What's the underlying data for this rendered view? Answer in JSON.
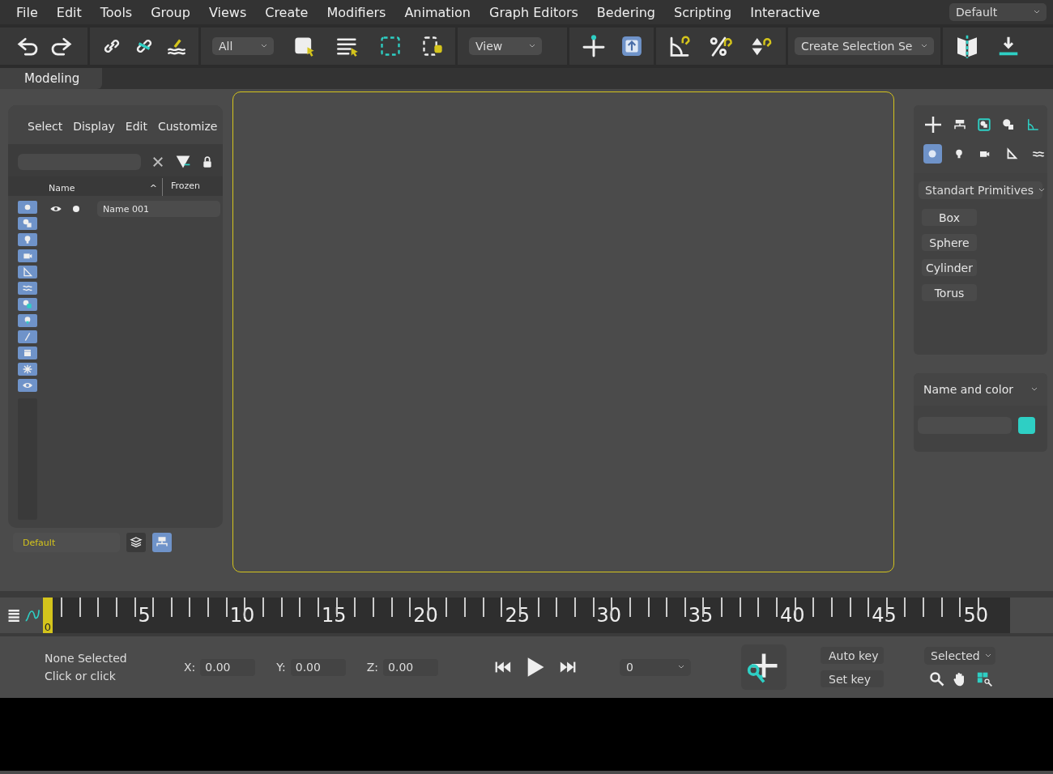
{
  "menu": [
    {
      "label": "File"
    },
    {
      "label": "Edit"
    },
    {
      "label": "Tools"
    },
    {
      "label": "Group"
    },
    {
      "label": "Views"
    },
    {
      "label": "Create"
    },
    {
      "label": "Modifiers"
    },
    {
      "label": "Animation"
    },
    {
      "label": "Graph Editors"
    },
    {
      "label": "Bedering"
    },
    {
      "label": "Scripting"
    },
    {
      "label": "Interactive"
    }
  ],
  "workspace": {
    "value": "Default"
  },
  "toolbar": {
    "selection_filter": "All",
    "reference_coordinate": "View",
    "named_selection": "Create Selection Se"
  },
  "ribbon_tabs": [
    {
      "label": "Modeling",
      "selected": true
    }
  ],
  "scene_explorer": {
    "menu": [
      "Select",
      "Display",
      "Edit",
      "Customize"
    ],
    "columns": [
      {
        "label": "Name",
        "sort_mark": "^"
      },
      {
        "label": "Frozen"
      }
    ],
    "rows": [
      {
        "name": "Name 001",
        "visible": true
      }
    ],
    "layer": {
      "value": "Default"
    }
  },
  "command_panel": {
    "object_types": [
      {
        "kind": "geometry",
        "selected": true
      },
      {
        "kind": "light",
        "selected": false
      },
      {
        "kind": "camera",
        "selected": false
      },
      {
        "kind": "helper",
        "selected": false
      },
      {
        "kind": "spacewarp",
        "selected": false
      }
    ],
    "category": "Standart Primitives",
    "buttons": [
      "Box",
      "Sphere",
      "Cylinder",
      "Torus"
    ],
    "rollout": {
      "title": "Name and color",
      "color": "#2ecfc4"
    }
  },
  "timeline": {
    "current_frame": "0",
    "level": 0,
    "labels": [
      "5",
      "10",
      "15",
      "20",
      "25",
      "30",
      "35",
      "40",
      "45",
      "50"
    ]
  },
  "status_bar": {
    "selection": "None Selected",
    "prompt": "Click or click",
    "coords": [
      {
        "axis": "X:",
        "value": "0.00"
      },
      {
        "axis": "Y:",
        "value": "0.00"
      },
      {
        "axis": "Z:",
        "value": "0.00"
      }
    ],
    "frame": "0",
    "auto_key": "Auto key",
    "set_key": "Set key",
    "key_filter": "Selected"
  }
}
